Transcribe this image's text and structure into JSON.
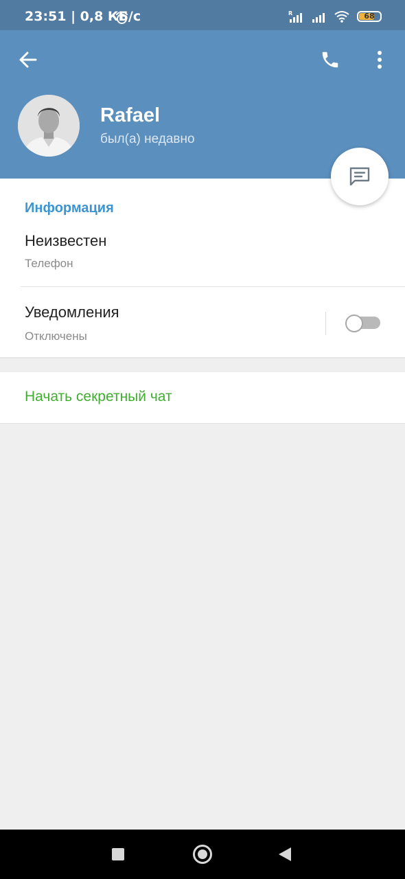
{
  "status_bar": {
    "time": "23:51 | 0,8 КБ/с",
    "battery": "68",
    "battery_level_percent": 68,
    "icons": [
      "alarm-icon",
      "signal-icon",
      "signal-icon",
      "wifi-icon",
      "battery-icon"
    ]
  },
  "header": {
    "icons": [
      "back-arrow-icon",
      "phone-icon",
      "more-vertical-icon"
    ],
    "name": "Rafael",
    "status": "был(а) недавно"
  },
  "fab": {
    "icon": "message-icon"
  },
  "info": {
    "section_title": "Информация",
    "phone_value": "Неизвестен",
    "phone_label": "Телефон",
    "notifications_title": "Уведомления",
    "notifications_sub": "Отключены",
    "notifications_enabled": false
  },
  "secret_chat": {
    "label": "Начать секретный чат"
  },
  "colors": {
    "header": "#5b8fbe",
    "status_bar": "#527ba2",
    "section_title": "#3b95d3",
    "secret_link": "#3fae2f",
    "background": "#efefef"
  },
  "nav_bar": {
    "icons": [
      "recents-square-icon",
      "home-circle-icon",
      "back-triangle-icon"
    ]
  }
}
